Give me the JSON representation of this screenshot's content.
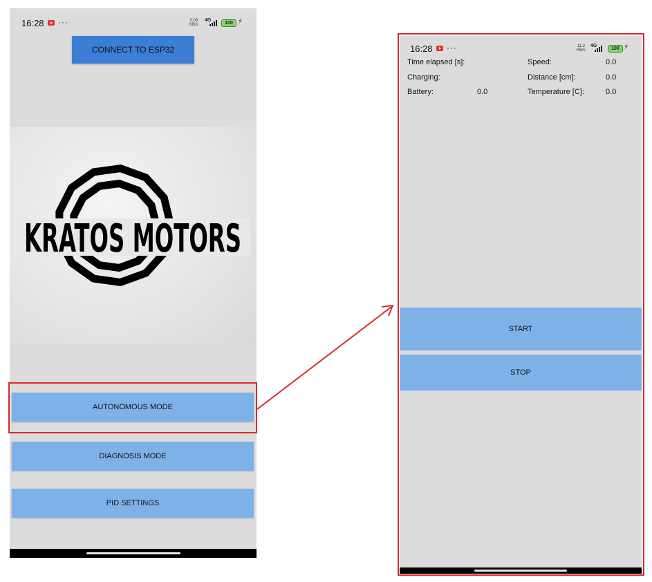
{
  "left_screen": {
    "status": {
      "time": "16:28",
      "netspeed_top": "0.03",
      "netspeed_bottom": "KB/s",
      "network": "4G",
      "battery": "100"
    },
    "connect_button": "CONNECT TO ESP32",
    "logo_text": "KRATOS MOTORS",
    "modes": [
      {
        "label": "AUTONOMOUS MODE"
      },
      {
        "label": "DIAGNOSIS MODE"
      },
      {
        "label": "PID SETTINGS"
      }
    ]
  },
  "right_screen": {
    "status": {
      "time": "16:28",
      "netspeed_top": "11.2",
      "netspeed_bottom": "KB/s",
      "network": "4G",
      "battery": "100"
    },
    "telemetry": {
      "time_elapsed_label": "Time elapsed [s]:",
      "charging_label": "Charging:",
      "battery_label": "Battery:",
      "battery_value": "0.0",
      "speed_label": "Speed:",
      "speed_value": "0.0",
      "distance_label": "Distance [cm]:",
      "distance_value": "0.0",
      "temperature_label": "Temperature [C]:",
      "temperature_value": "0.0"
    },
    "start_button": "START",
    "stop_button": "STOP"
  },
  "colors": {
    "screen_bg": "#dcdcdc",
    "connect_button": "#3c7dd6",
    "mode_button": "#7db1e8",
    "highlight": "#d62b2f"
  }
}
